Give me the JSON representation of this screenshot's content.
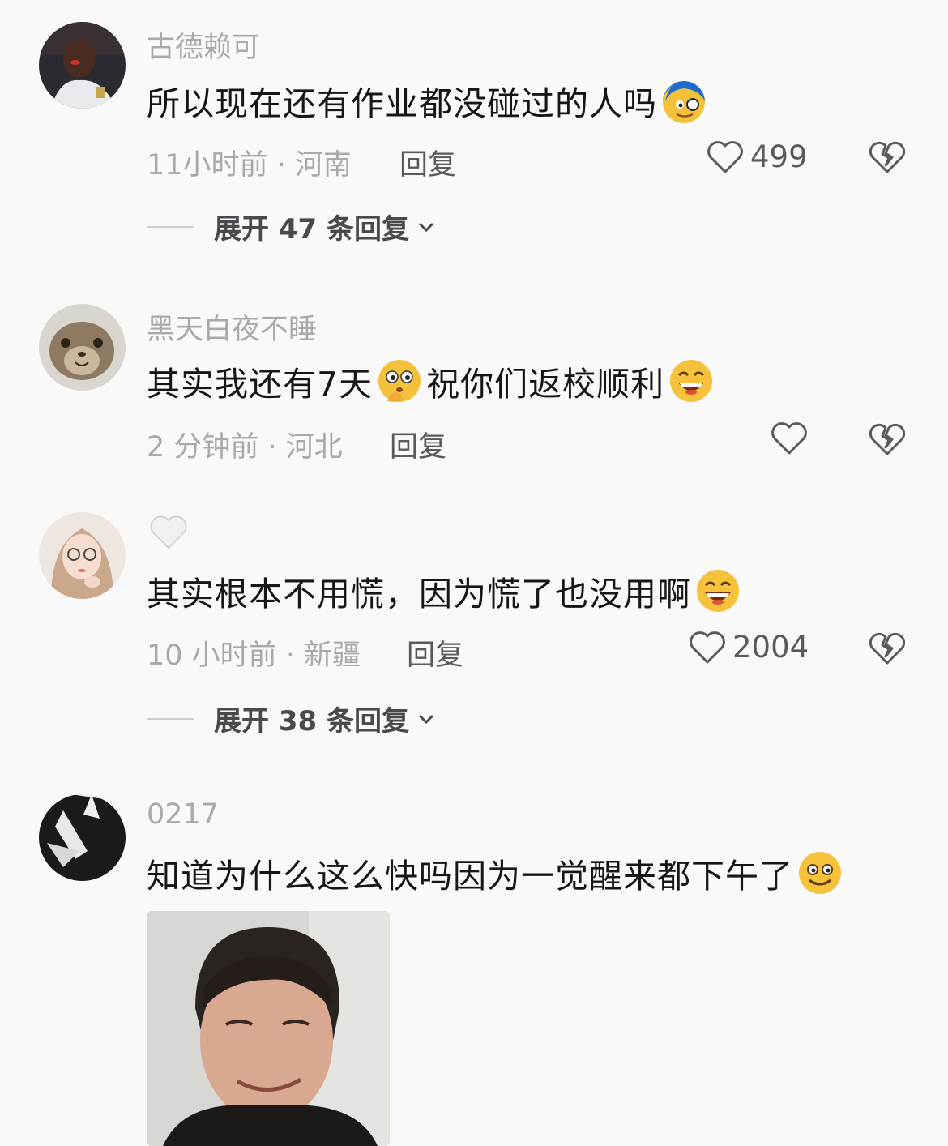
{
  "comments": [
    {
      "author": "古德赖可",
      "text": "所以现在还有作业都没碰过的人吗",
      "emoji": "nervous-blue-face-emoji",
      "time_location": "11小时前 · 河南",
      "reply_label": "回复",
      "likes": "499",
      "expand_label": "展开 47 条回复"
    },
    {
      "author": "黑天白夜不睡",
      "text_part1": "其实我还有7天",
      "emoji1": "thinking-face-emoji",
      "text_part2": "祝你们返校顺利",
      "emoji2": "grinning-face-emoji",
      "time_location": "2 分钟前 · 河北",
      "reply_label": "回复"
    },
    {
      "author_icon": "white-heart-icon",
      "text": "其实根本不用慌，因为慌了也没用啊",
      "emoji": "grinning-face-emoji",
      "time_location": "10 小时前 · 新疆",
      "reply_label": "回复",
      "likes": "2004",
      "expand_label": "展开 38 条回复"
    },
    {
      "author": "0217",
      "text": "知道为什么这么快吗因为一觉醒来都下午了",
      "emoji": "silly-smile-emoji",
      "attachment": "meme-photo"
    }
  ]
}
